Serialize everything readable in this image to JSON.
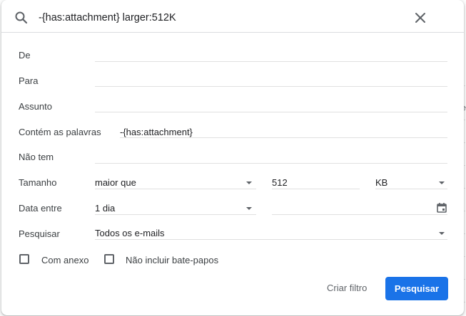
{
  "search": {
    "query": "-{has:attachment} larger:512K"
  },
  "form": {
    "from_label": "De",
    "to_label": "Para",
    "subject_label": "Assunto",
    "has_words_label": "Contém as palavras",
    "has_words_value": "-{has:attachment}",
    "doesnt_have_label": "Não tem",
    "size_label": "Tamanho",
    "size_operator": "maior que",
    "size_value": "512",
    "size_unit": "KB",
    "date_label": "Data entre",
    "date_range": "1 dia",
    "search_in_label": "Pesquisar",
    "search_in_value": "Todos os e-mails",
    "has_attachment_label": "Com anexo",
    "exclude_chats_label": "Não incluir bate-papos"
  },
  "actions": {
    "create_filter": "Criar filtro",
    "search": "Pesquisar"
  },
  "colors": {
    "primary": "#1a73e8",
    "divider": "#e0e0e0"
  }
}
